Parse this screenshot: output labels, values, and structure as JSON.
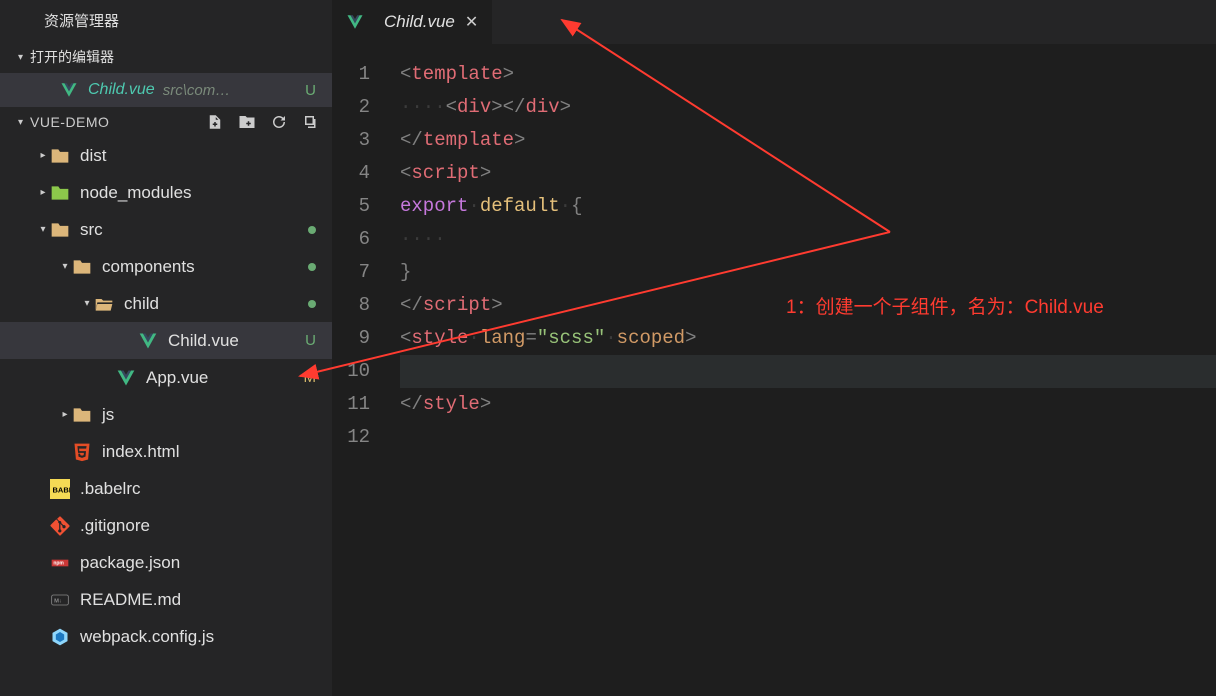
{
  "explorer": {
    "title": "资源管理器",
    "sections": {
      "open_editors": {
        "label": "打开的编辑器",
        "items": [
          {
            "name": "Child.vue",
            "path": "src\\com…",
            "badge": "U"
          }
        ]
      },
      "project": {
        "name": "VUE-DEMO",
        "tree": [
          {
            "label": "dist",
            "type": "folder",
            "indent": 0,
            "expanded": false
          },
          {
            "label": "node_modules",
            "type": "folder-node",
            "indent": 0,
            "expanded": false
          },
          {
            "label": "src",
            "type": "folder-src",
            "indent": 0,
            "expanded": true,
            "dot": true
          },
          {
            "label": "components",
            "type": "folder",
            "indent": 1,
            "expanded": true,
            "dot": true
          },
          {
            "label": "child",
            "type": "folder-open",
            "indent": 2,
            "expanded": true,
            "dot": true
          },
          {
            "label": "Child.vue",
            "type": "vue",
            "indent": 4,
            "badge": "U",
            "selected": true
          },
          {
            "label": "App.vue",
            "type": "vue",
            "indent": 3,
            "badge": "M"
          },
          {
            "label": "js",
            "type": "folder-js",
            "indent": 1,
            "expanded": false
          },
          {
            "label": "index.html",
            "type": "html",
            "indent": 1
          },
          {
            "label": ".babelrc",
            "type": "babel",
            "indent": 0
          },
          {
            "label": ".gitignore",
            "type": "git",
            "indent": 0
          },
          {
            "label": "package.json",
            "type": "npm",
            "indent": 0
          },
          {
            "label": "README.md",
            "type": "md",
            "indent": 0
          },
          {
            "label": "webpack.config.js",
            "type": "webpack",
            "indent": 0
          }
        ]
      }
    }
  },
  "editor": {
    "tab": {
      "label": "Child.vue"
    },
    "lines": 12
  },
  "annotation": {
    "text": "1：创建一个子组件，名为：Child.vue"
  }
}
